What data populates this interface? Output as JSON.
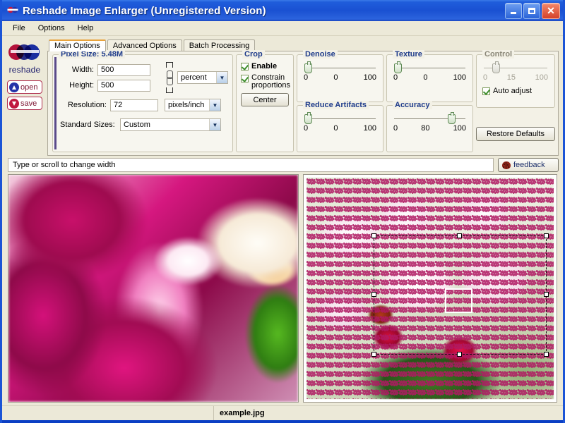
{
  "window": {
    "title": "Reshade Image Enlarger (Unregistered Version)",
    "icon": "reshade-logo-icon",
    "minimize_label": "Minimize",
    "maximize_label": "Maximize",
    "close_label": "Close"
  },
  "menu": {
    "items": [
      "File",
      "Options",
      "Help"
    ]
  },
  "sidebar": {
    "logo_text": "reshade",
    "open_label": "open",
    "save_label": "save"
  },
  "tabs": [
    {
      "label": "Main Options",
      "active": true
    },
    {
      "label": "Advanced Options",
      "active": false
    },
    {
      "label": "Batch Processing",
      "active": false
    }
  ],
  "pixel_size": {
    "legend": "Pixel Size: 5.48M",
    "width_label": "Width:",
    "width_value": "500",
    "height_label": "Height:",
    "height_value": "500",
    "unit_value": "percent",
    "resolution_label": "Resolution:",
    "resolution_value": "72",
    "resolution_unit": "pixels/inch",
    "standard_sizes_label": "Standard Sizes:",
    "standard_sizes_value": "Custom",
    "link_icon": "chain-link-icon"
  },
  "crop": {
    "legend": "Crop",
    "enable_label": "Enable",
    "enable_checked": true,
    "constrain_label": "Constrain proportions",
    "constrain_checked": true,
    "center_label": "Center"
  },
  "sliders": [
    {
      "legend": "Denoise",
      "min": "0",
      "value": "0",
      "max": "100",
      "percent": 0,
      "disabled": false
    },
    {
      "legend": "Texture",
      "min": "0",
      "value": "0",
      "max": "100",
      "percent": 0,
      "disabled": false
    },
    {
      "legend": "Reduce Artifacts",
      "min": "0",
      "value": "0",
      "max": "100",
      "percent": 0,
      "disabled": false
    },
    {
      "legend": "Accuracy",
      "min": "0",
      "value": "80",
      "max": "100",
      "percent": 80,
      "disabled": false
    },
    {
      "legend": "Control",
      "min": "0",
      "value": "15",
      "max": "100",
      "percent": 15,
      "disabled": true
    }
  ],
  "control": {
    "auto_adjust_label": "Auto adjust",
    "auto_adjust_checked": true,
    "restore_defaults_label": "Restore Defaults"
  },
  "hint_bar": {
    "text": "Type or scroll to change width",
    "feedback_label": "feedback",
    "feedback_icon": "ladybug-icon"
  },
  "preview": {
    "left_alt": "magnified orchid detail preview",
    "right_alt": "full orchid photo with crop selection",
    "crop_handle_count": 8
  },
  "statusbar": {
    "filename": "example.jpg"
  },
  "colors": {
    "titlebar": "#1f5ddb",
    "accent_tab": "#e8a33d",
    "group_legend": "#1f3c8b",
    "check": "#3f8f2e",
    "window_bg": "#ece9d8"
  }
}
